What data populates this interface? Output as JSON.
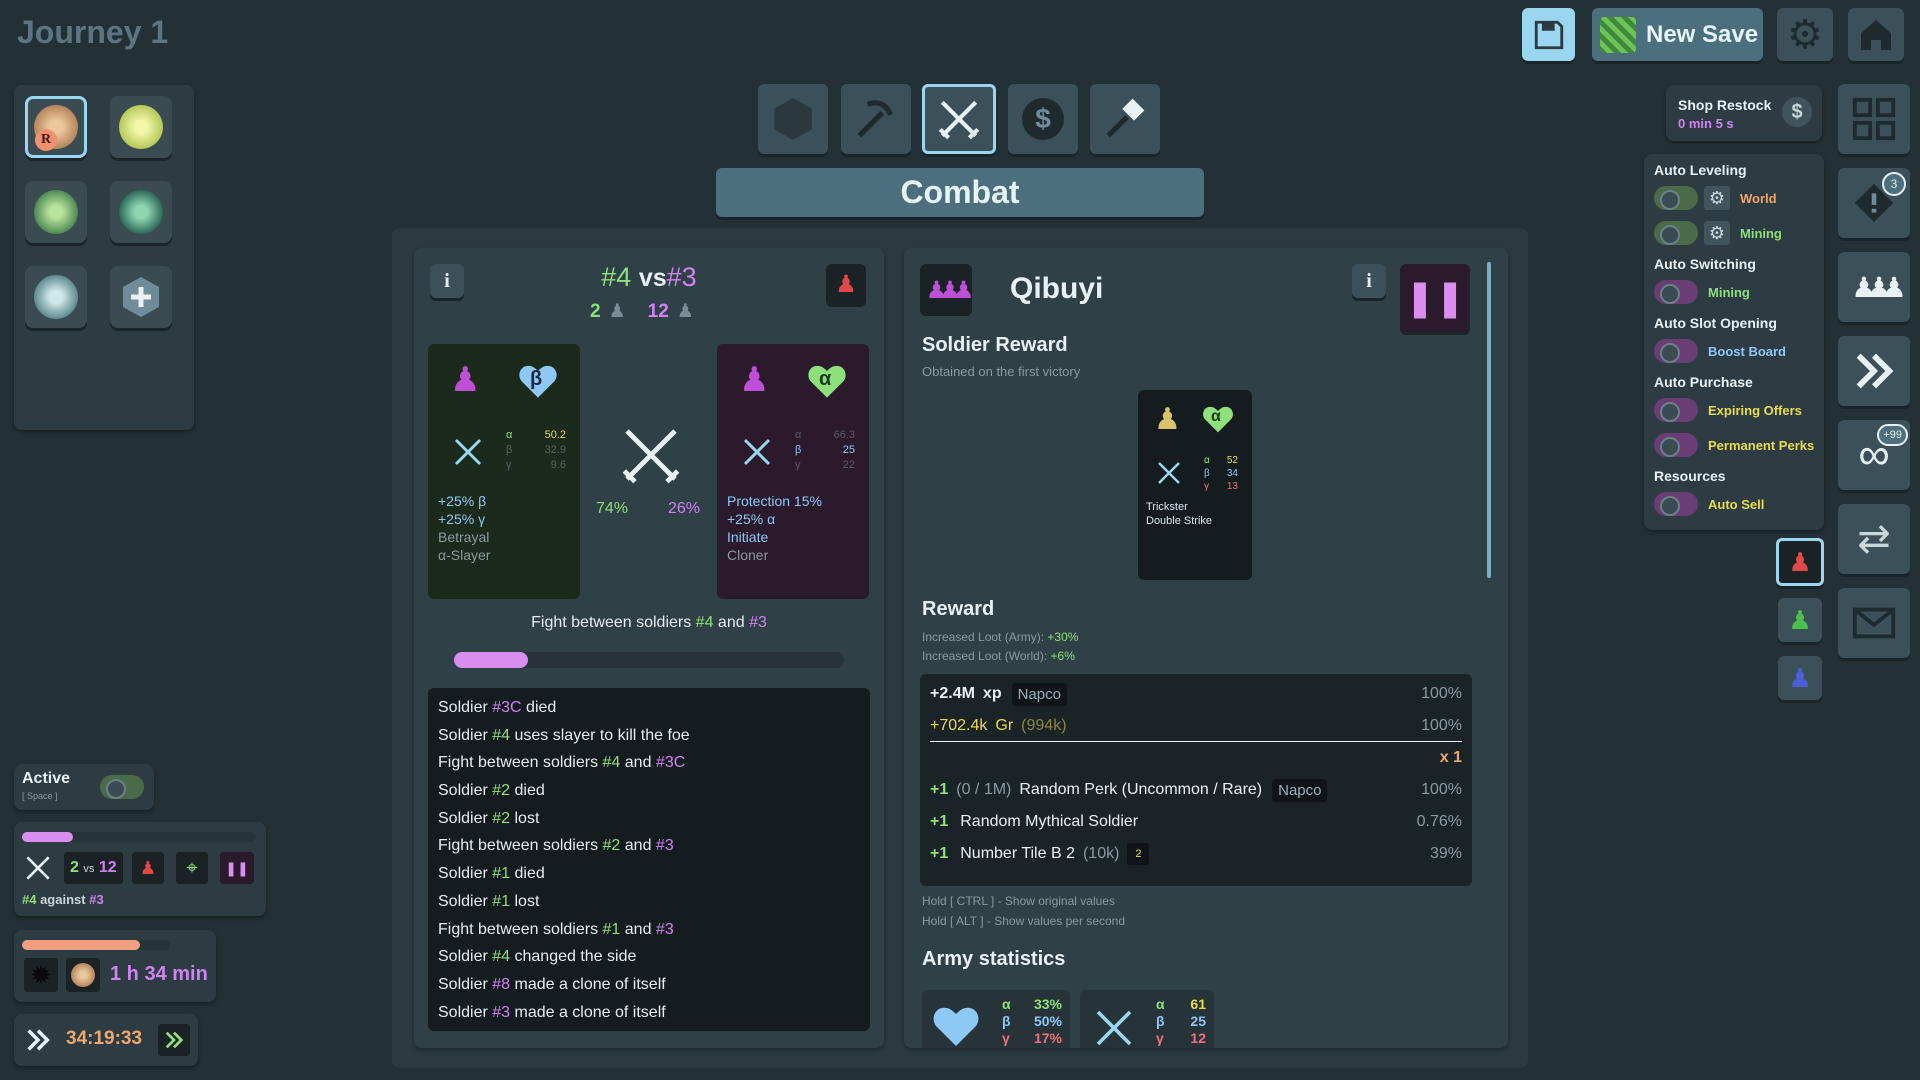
{
  "header": {
    "title": "Journey 1",
    "new_save_label": "New Save"
  },
  "tool_tabs": [
    "hexagon-icon",
    "pickaxe-icon",
    "crossed-swords-icon",
    "dollar-token-icon",
    "hammer-icon"
  ],
  "section_title": "Combat",
  "battle": {
    "left_id": "#4",
    "vs": "vs",
    "right_id": "#3",
    "left_count": "2",
    "right_count": "12",
    "left_card": {
      "greek": "β",
      "stats": {
        "a": "50.2",
        "b": "32.9",
        "c": "9.6"
      },
      "perks": [
        "+25% β",
        "+25% γ",
        "Betrayal",
        "α-Slayer"
      ]
    },
    "right_card": {
      "greek": "α",
      "stats": {
        "a": "66.3",
        "b": "25",
        "c": "22"
      },
      "perks": [
        "Protection 15%",
        "+25% α",
        "Initiate",
        "Cloner"
      ]
    },
    "left_pct": "74%",
    "right_pct": "26%",
    "status_prefix": "Fight between soldiers ",
    "status_a": "#4",
    "status_and": " and ",
    "status_b": "#3",
    "progress": 0.19
  },
  "log": [
    [
      "Soldier ",
      "#3C",
      " died"
    ],
    [
      "Soldier ",
      "#4",
      " uses slayer to kill the foe"
    ],
    [
      "Fight between soldiers ",
      "#4",
      " and ",
      "#3C"
    ],
    [
      "Soldier ",
      "#2",
      " died"
    ],
    [
      "Soldier ",
      "#2",
      " lost"
    ],
    [
      "Fight between soldiers ",
      "#2",
      " and ",
      "#3"
    ],
    [
      "Soldier ",
      "#1",
      " died"
    ],
    [
      "Soldier ",
      "#1",
      " lost"
    ],
    [
      "Fight between soldiers ",
      "#1",
      " and ",
      "#3"
    ],
    [
      "Soldier ",
      "#4",
      " changed the side"
    ],
    [
      "Soldier ",
      "#8",
      " made a clone of itself"
    ],
    [
      "Soldier ",
      "#3",
      " made a clone of itself"
    ]
  ],
  "enemy": {
    "name": "Qibuyi",
    "soldier_reward_title": "Soldier Reward",
    "soldier_reward_sub": "Obtained on the first victory",
    "reward_card": {
      "greek": "α",
      "stats": {
        "a": "52",
        "b": "34",
        "c": "13"
      },
      "perks": [
        "Trickster",
        "Double Strike"
      ]
    },
    "reward_title": "Reward",
    "loot_army_label": "Increased Loot (Army):",
    "loot_army_val": "+30%",
    "loot_world_label": "Increased Loot (World):",
    "loot_world_val": "+6%",
    "xp_amount": "+2.4M",
    "xp_label": "xp",
    "xp_tag": "Napco",
    "xp_pct": "100%",
    "gr_amount": "+702.4k",
    "gr_label": "Gr",
    "gr_extra": "(994k)",
    "gr_pct": "100%",
    "multiplier": "x 1",
    "perk_amount": "+1",
    "perk_progress": "(0 / 1M)",
    "perk_label": "Random Perk (Uncommon / Rare)",
    "perk_tag": "Napco",
    "perk_pct": "100%",
    "myth_amount": "+1",
    "myth_label": "Random Mythical Soldier",
    "myth_pct": "0.76%",
    "tile_amount": "+1",
    "tile_label": "Number Tile B 2",
    "tile_extra": "(10k)",
    "tile_pct": "39%",
    "hint_ctrl": "Hold [ CTRL ] - Show original values",
    "hint_alt": "Hold [ ALT ] - Show values per second",
    "army_stats_title": "Army statistics",
    "army_pct": {
      "a": "33%",
      "b": "50%",
      "c": "17%"
    },
    "army_vals": {
      "a": "61",
      "b": "25",
      "c": "12"
    }
  },
  "shop": {
    "label": "Shop Restock",
    "time": "0 min 5 s"
  },
  "automation": {
    "auto_leveling": "Auto Leveling",
    "world": "World",
    "mining": "Mining",
    "auto_switching": "Auto Switching",
    "switch_mining": "Mining",
    "auto_slot": "Auto Slot Opening",
    "boost_board": "Boost Board",
    "auto_purchase": "Auto Purchase",
    "expiring": "Expiring Offers",
    "permanent": "Permanent Perks",
    "resources": "Resources",
    "auto_sell": "Auto Sell"
  },
  "side_badges": {
    "alert": "3",
    "infinity": "+99"
  },
  "bottom_left": {
    "active_label": "Active",
    "active_hint": "[ Space ]",
    "mini_left": "2",
    "mini_vs": "vs",
    "mini_right": "12",
    "mini_id_a": "#4",
    "mini_against": " against ",
    "mini_id_b": "#3",
    "timer_label": "1 h 34 min",
    "clock": "34:19:33",
    "mini_progress": 0.22,
    "timer_progress": 0.8
  },
  "map_badge": "R",
  "colors": {
    "accent_blue": "#9ad6f0",
    "green": "#8ee07a",
    "purple": "#d082f0",
    "red": "#e24848"
  }
}
